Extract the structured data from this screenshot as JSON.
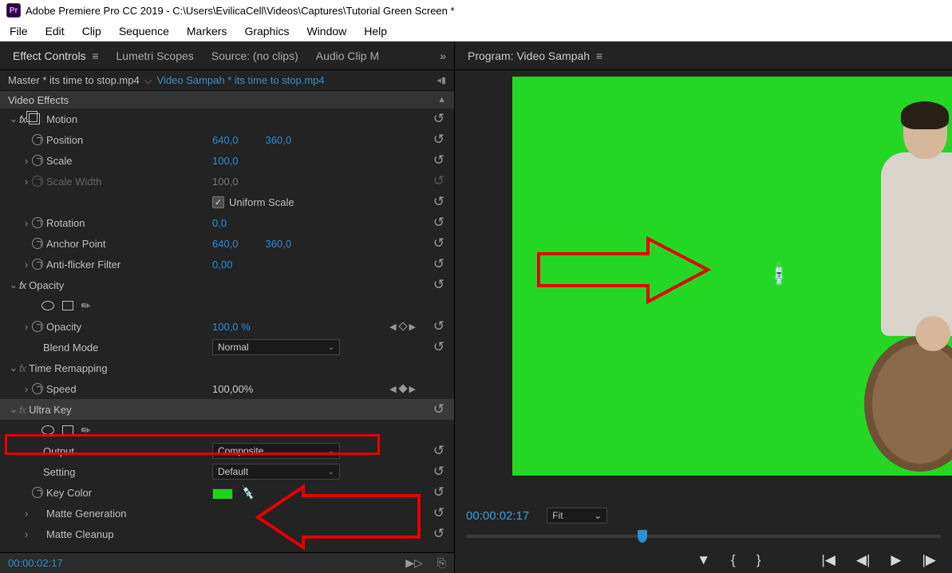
{
  "app": {
    "icon_text": "Pr",
    "title": "Adobe Premiere Pro CC 2019 - C:\\Users\\EvilicaCell\\Videos\\Captures\\Tutorial Green Screen *"
  },
  "menu": [
    "File",
    "Edit",
    "Clip",
    "Sequence",
    "Markers",
    "Graphics",
    "Window",
    "Help"
  ],
  "panel_tabs": {
    "effect_controls": "Effect Controls",
    "lumetri": "Lumetri Scopes",
    "source": "Source: (no clips)",
    "audio": "Audio Clip M"
  },
  "master_row": {
    "master": "Master * its time to stop.mp4",
    "clip": "Video Sampah * its time to stop.mp4"
  },
  "sections": {
    "video_effects": "Video Effects"
  },
  "motion": {
    "title": "Motion",
    "position": {
      "label": "Position",
      "x": "640,0",
      "y": "360,0"
    },
    "scale": {
      "label": "Scale",
      "value": "100,0"
    },
    "scale_width": {
      "label": "Scale Width",
      "value": "100,0"
    },
    "uniform": "Uniform Scale",
    "rotation": {
      "label": "Rotation",
      "value": "0,0"
    },
    "anchor": {
      "label": "Anchor Point",
      "x": "640,0",
      "y": "360,0"
    },
    "antiflicker": {
      "label": "Anti-flicker Filter",
      "value": "0,00"
    }
  },
  "opacity": {
    "title": "Opacity",
    "opacity": {
      "label": "Opacity",
      "value": "100,0 %"
    },
    "blend": {
      "label": "Blend Mode",
      "value": "Normal"
    }
  },
  "time": {
    "title": "Time Remapping",
    "speed": {
      "label": "Speed",
      "value": "100,00%"
    }
  },
  "ultrakey": {
    "title": "Ultra Key",
    "output": {
      "label": "Output",
      "value": "Composite"
    },
    "setting": {
      "label": "Setting",
      "value": "Default"
    },
    "keycolor": {
      "label": "Key Color"
    },
    "matte_gen": "Matte Generation",
    "matte_clean": "Matte Cleanup"
  },
  "footer": {
    "timecode": "00:00:02:17"
  },
  "program": {
    "title": "Program: Video Sampah",
    "timecode": "00:00:02:17",
    "zoom": "Fit"
  }
}
